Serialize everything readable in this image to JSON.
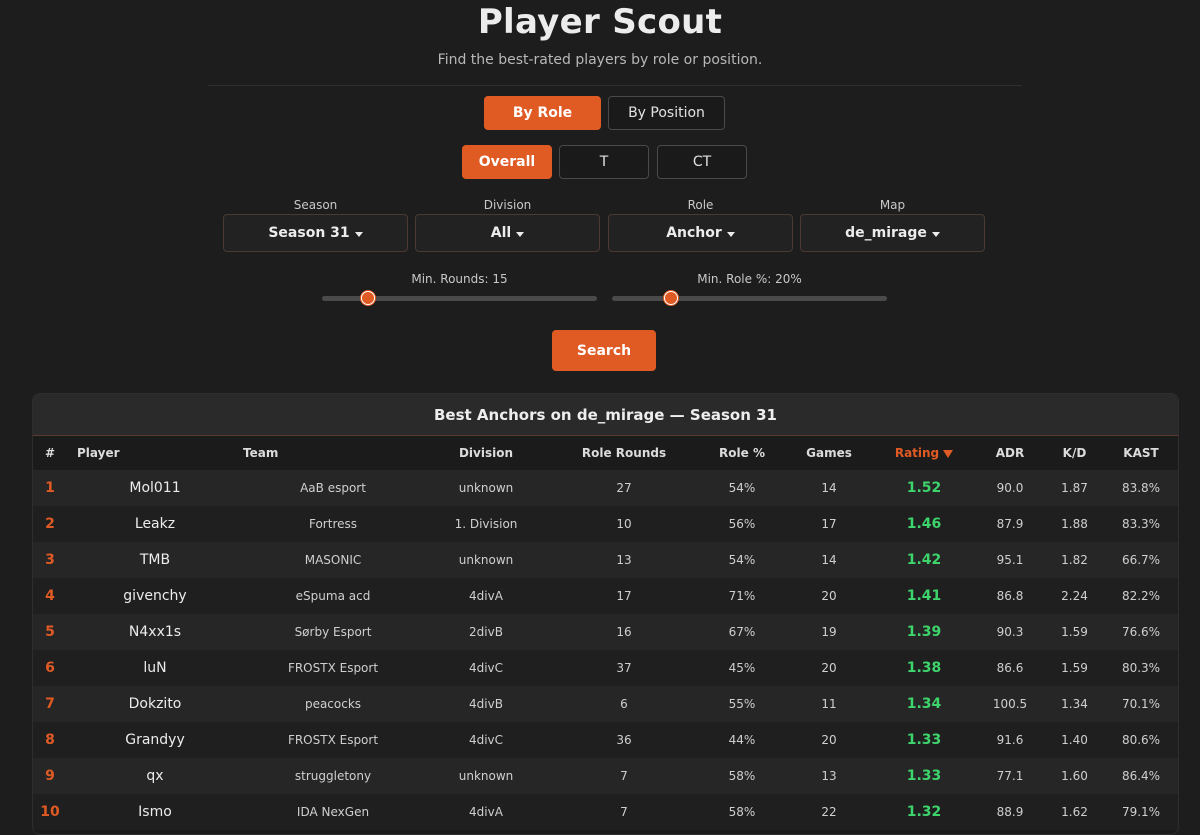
{
  "header": {
    "title": "Player Scout",
    "subtitle": "Find the best-rated players by role or position."
  },
  "mode_tabs": [
    {
      "label": "By Role",
      "active": true
    },
    {
      "label": "By Position",
      "active": false
    }
  ],
  "side_tabs": [
    {
      "label": "Overall",
      "active": true
    },
    {
      "label": "T",
      "active": false
    },
    {
      "label": "CT",
      "active": false
    }
  ],
  "filters": {
    "season": {
      "label": "Season",
      "value": "Season 31"
    },
    "division": {
      "label": "Division",
      "value": "All"
    },
    "role": {
      "label": "Role",
      "value": "Anchor"
    },
    "map": {
      "label": "Map",
      "value": "de_mirage"
    }
  },
  "sliders": {
    "min_rounds": {
      "label": "Min. Rounds: 15",
      "value": 15
    },
    "min_role_pct": {
      "label": "Min. Role %: 20%",
      "value": 20
    }
  },
  "search_label": "Search",
  "results": {
    "title": "Best Anchors on de_mirage — Season 31",
    "columns": [
      "#",
      "Player",
      "Team",
      "Division",
      "Role Rounds",
      "Role %",
      "Games",
      "Rating",
      "ADR",
      "K/D",
      "KAST"
    ],
    "sorted_column": "Rating",
    "rows": [
      {
        "rank": "1",
        "player": "Mol011",
        "team": "AaB esport",
        "division": "unknown",
        "role_rounds": "27",
        "role_pct": "54%",
        "games": "14",
        "rating": "1.52",
        "adr": "90.0",
        "kd": "1.87",
        "kast": "83.8%"
      },
      {
        "rank": "2",
        "player": "Leakz",
        "team": "Fortress",
        "division": "1. Division",
        "role_rounds": "10",
        "role_pct": "56%",
        "games": "17",
        "rating": "1.46",
        "adr": "87.9",
        "kd": "1.88",
        "kast": "83.3%"
      },
      {
        "rank": "3",
        "player": "TMB",
        "team": "MASONIC",
        "division": "unknown",
        "role_rounds": "13",
        "role_pct": "54%",
        "games": "14",
        "rating": "1.42",
        "adr": "95.1",
        "kd": "1.82",
        "kast": "66.7%"
      },
      {
        "rank": "4",
        "player": "givenchy",
        "team": "eSpuma acd",
        "division": "4divA",
        "role_rounds": "17",
        "role_pct": "71%",
        "games": "20",
        "rating": "1.41",
        "adr": "86.8",
        "kd": "2.24",
        "kast": "82.2%"
      },
      {
        "rank": "5",
        "player": "N4xx1s",
        "team": "Sørby Esport",
        "division": "2divB",
        "role_rounds": "16",
        "role_pct": "67%",
        "games": "19",
        "rating": "1.39",
        "adr": "90.3",
        "kd": "1.59",
        "kast": "76.6%"
      },
      {
        "rank": "6",
        "player": "luN",
        "team": "FROSTX Esport",
        "division": "4divC",
        "role_rounds": "37",
        "role_pct": "45%",
        "games": "20",
        "rating": "1.38",
        "adr": "86.6",
        "kd": "1.59",
        "kast": "80.3%"
      },
      {
        "rank": "7",
        "player": "Dokzito",
        "team": "peacocks",
        "division": "4divB",
        "role_rounds": "6",
        "role_pct": "55%",
        "games": "11",
        "rating": "1.34",
        "adr": "100.5",
        "kd": "1.34",
        "kast": "70.1%"
      },
      {
        "rank": "8",
        "player": "Grandyy",
        "team": "FROSTX Esport",
        "division": "4divC",
        "role_rounds": "36",
        "role_pct": "44%",
        "games": "20",
        "rating": "1.33",
        "adr": "91.6",
        "kd": "1.40",
        "kast": "80.6%"
      },
      {
        "rank": "9",
        "player": "qx",
        "team": "struggletony",
        "division": "unknown",
        "role_rounds": "7",
        "role_pct": "58%",
        "games": "13",
        "rating": "1.33",
        "adr": "77.1",
        "kd": "1.60",
        "kast": "86.4%"
      },
      {
        "rank": "10",
        "player": "Ismo",
        "team": "IDA NexGen",
        "division": "4divA",
        "role_rounds": "7",
        "role_pct": "58%",
        "games": "22",
        "rating": "1.32",
        "adr": "88.9",
        "kd": "1.62",
        "kast": "79.1%"
      }
    ]
  },
  "colors": {
    "accent": "#e05a24",
    "rating_green": "#3dd46b",
    "background": "#1d1d1d"
  }
}
